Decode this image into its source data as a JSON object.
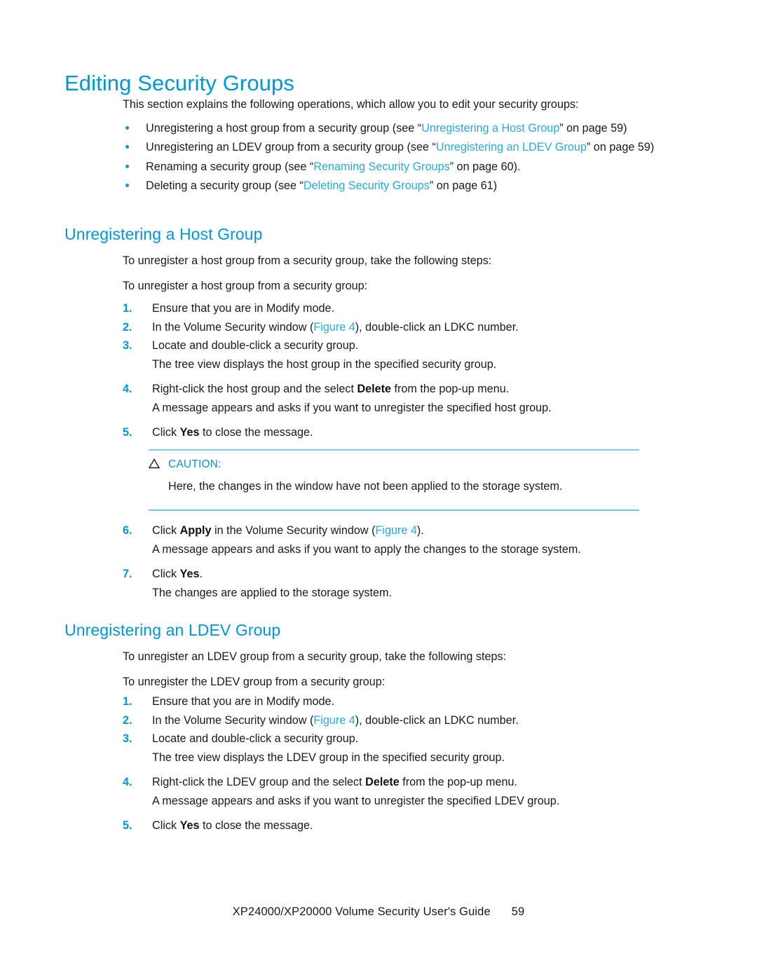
{
  "document": {
    "title": "Editing Security Groups",
    "intro": "This section explains the following operations, which allow you to edit your security groups:"
  },
  "bullets": [
    {
      "pre": "Unregistering a host group from a security group (see “",
      "link": "Unregistering a Host Group",
      "post": "” on page 59)"
    },
    {
      "pre": "Unregistering an LDEV group from a security group (see “",
      "link": "Unregistering an LDEV Group",
      "post": "” on page 59)"
    },
    {
      "pre": "Renaming a security group (see “",
      "link": "Renaming Security Groups",
      "post": "” on page 60)."
    },
    {
      "pre": "Deleting a security group (see “",
      "link": "Deleting Security Groups",
      "post": "” on page 61)"
    }
  ],
  "section_host": {
    "heading": "Unregistering a Host Group",
    "lead1": "To unregister a host group from a security group, take the following steps:",
    "lead2": "To unregister a host group from a security group:",
    "steps": [
      {
        "num": "1.",
        "pre": "Ensure that you are in Modify mode.",
        "bold": "",
        "post": "",
        "result": ""
      },
      {
        "num": "2.",
        "pre": "In the Volume Security window (",
        "link": "Figure 4",
        "post": "), double-click an LDKC number.",
        "result": ""
      },
      {
        "num": "3.",
        "pre": "Locate and double-click a security group.",
        "bold": "",
        "post": "",
        "result": "The tree view displays the host group in the specified security group."
      },
      {
        "num": "4.",
        "pre": "Right-click the host group and the select ",
        "bold": "Delete",
        "post": " from the pop-up menu.",
        "result": "A message appears and asks if you want to unregister the specified host group."
      },
      {
        "num": "5.",
        "pre": "Click ",
        "bold": "Yes",
        "post": " to close the message.",
        "result": ""
      }
    ],
    "caution": {
      "icon": "caution-triangle-icon",
      "label": "CAUTION:",
      "text": "Here, the changes in the window have not been applied to the storage system."
    },
    "steps_after": [
      {
        "num": "6.",
        "pre": "Click ",
        "bold": "Apply",
        "mid": " in the Volume Security window (",
        "link": "Figure 4",
        "post": ").",
        "result": "A message appears and asks if you want to apply the changes to the storage system."
      },
      {
        "num": "7.",
        "pre": "Click ",
        "bold": "Yes",
        "post": ".",
        "result": "The changes are applied to the storage system."
      }
    ]
  },
  "section_ldev": {
    "heading": "Unregistering an LDEV Group",
    "lead1": "To unregister an LDEV group from a security group, take the following steps:",
    "lead2": "To unregister the LDEV group from a security group:",
    "steps": [
      {
        "num": "1.",
        "pre": "Ensure that you are in Modify mode.",
        "bold": "",
        "post": "",
        "result": ""
      },
      {
        "num": "2.",
        "pre": "In the Volume Security window (",
        "link": "Figure 4",
        "post": "), double-click an LDKC number.",
        "result": ""
      },
      {
        "num": "3.",
        "pre": "Locate and double-click a security group.",
        "bold": "",
        "post": "",
        "result": "The tree view displays the LDEV group in the specified security group."
      },
      {
        "num": "4.",
        "pre": "Right-click the LDEV group and the select ",
        "bold": "Delete",
        "post": " from the pop-up menu.",
        "result": "A message appears and asks if you want to unregister the specified LDEV group."
      },
      {
        "num": "5.",
        "pre": "Click ",
        "bold": "Yes",
        "post": " to close the message.",
        "result": ""
      }
    ]
  },
  "footer": {
    "guide": "XP24000/XP20000 Volume Security User's Guide",
    "page_number": "59"
  },
  "colors": {
    "heading_blue": "#0096D6",
    "link_blue": "#29A8E0",
    "rule_blue": "#79CDEE",
    "body_text": "#1A1A1A"
  }
}
